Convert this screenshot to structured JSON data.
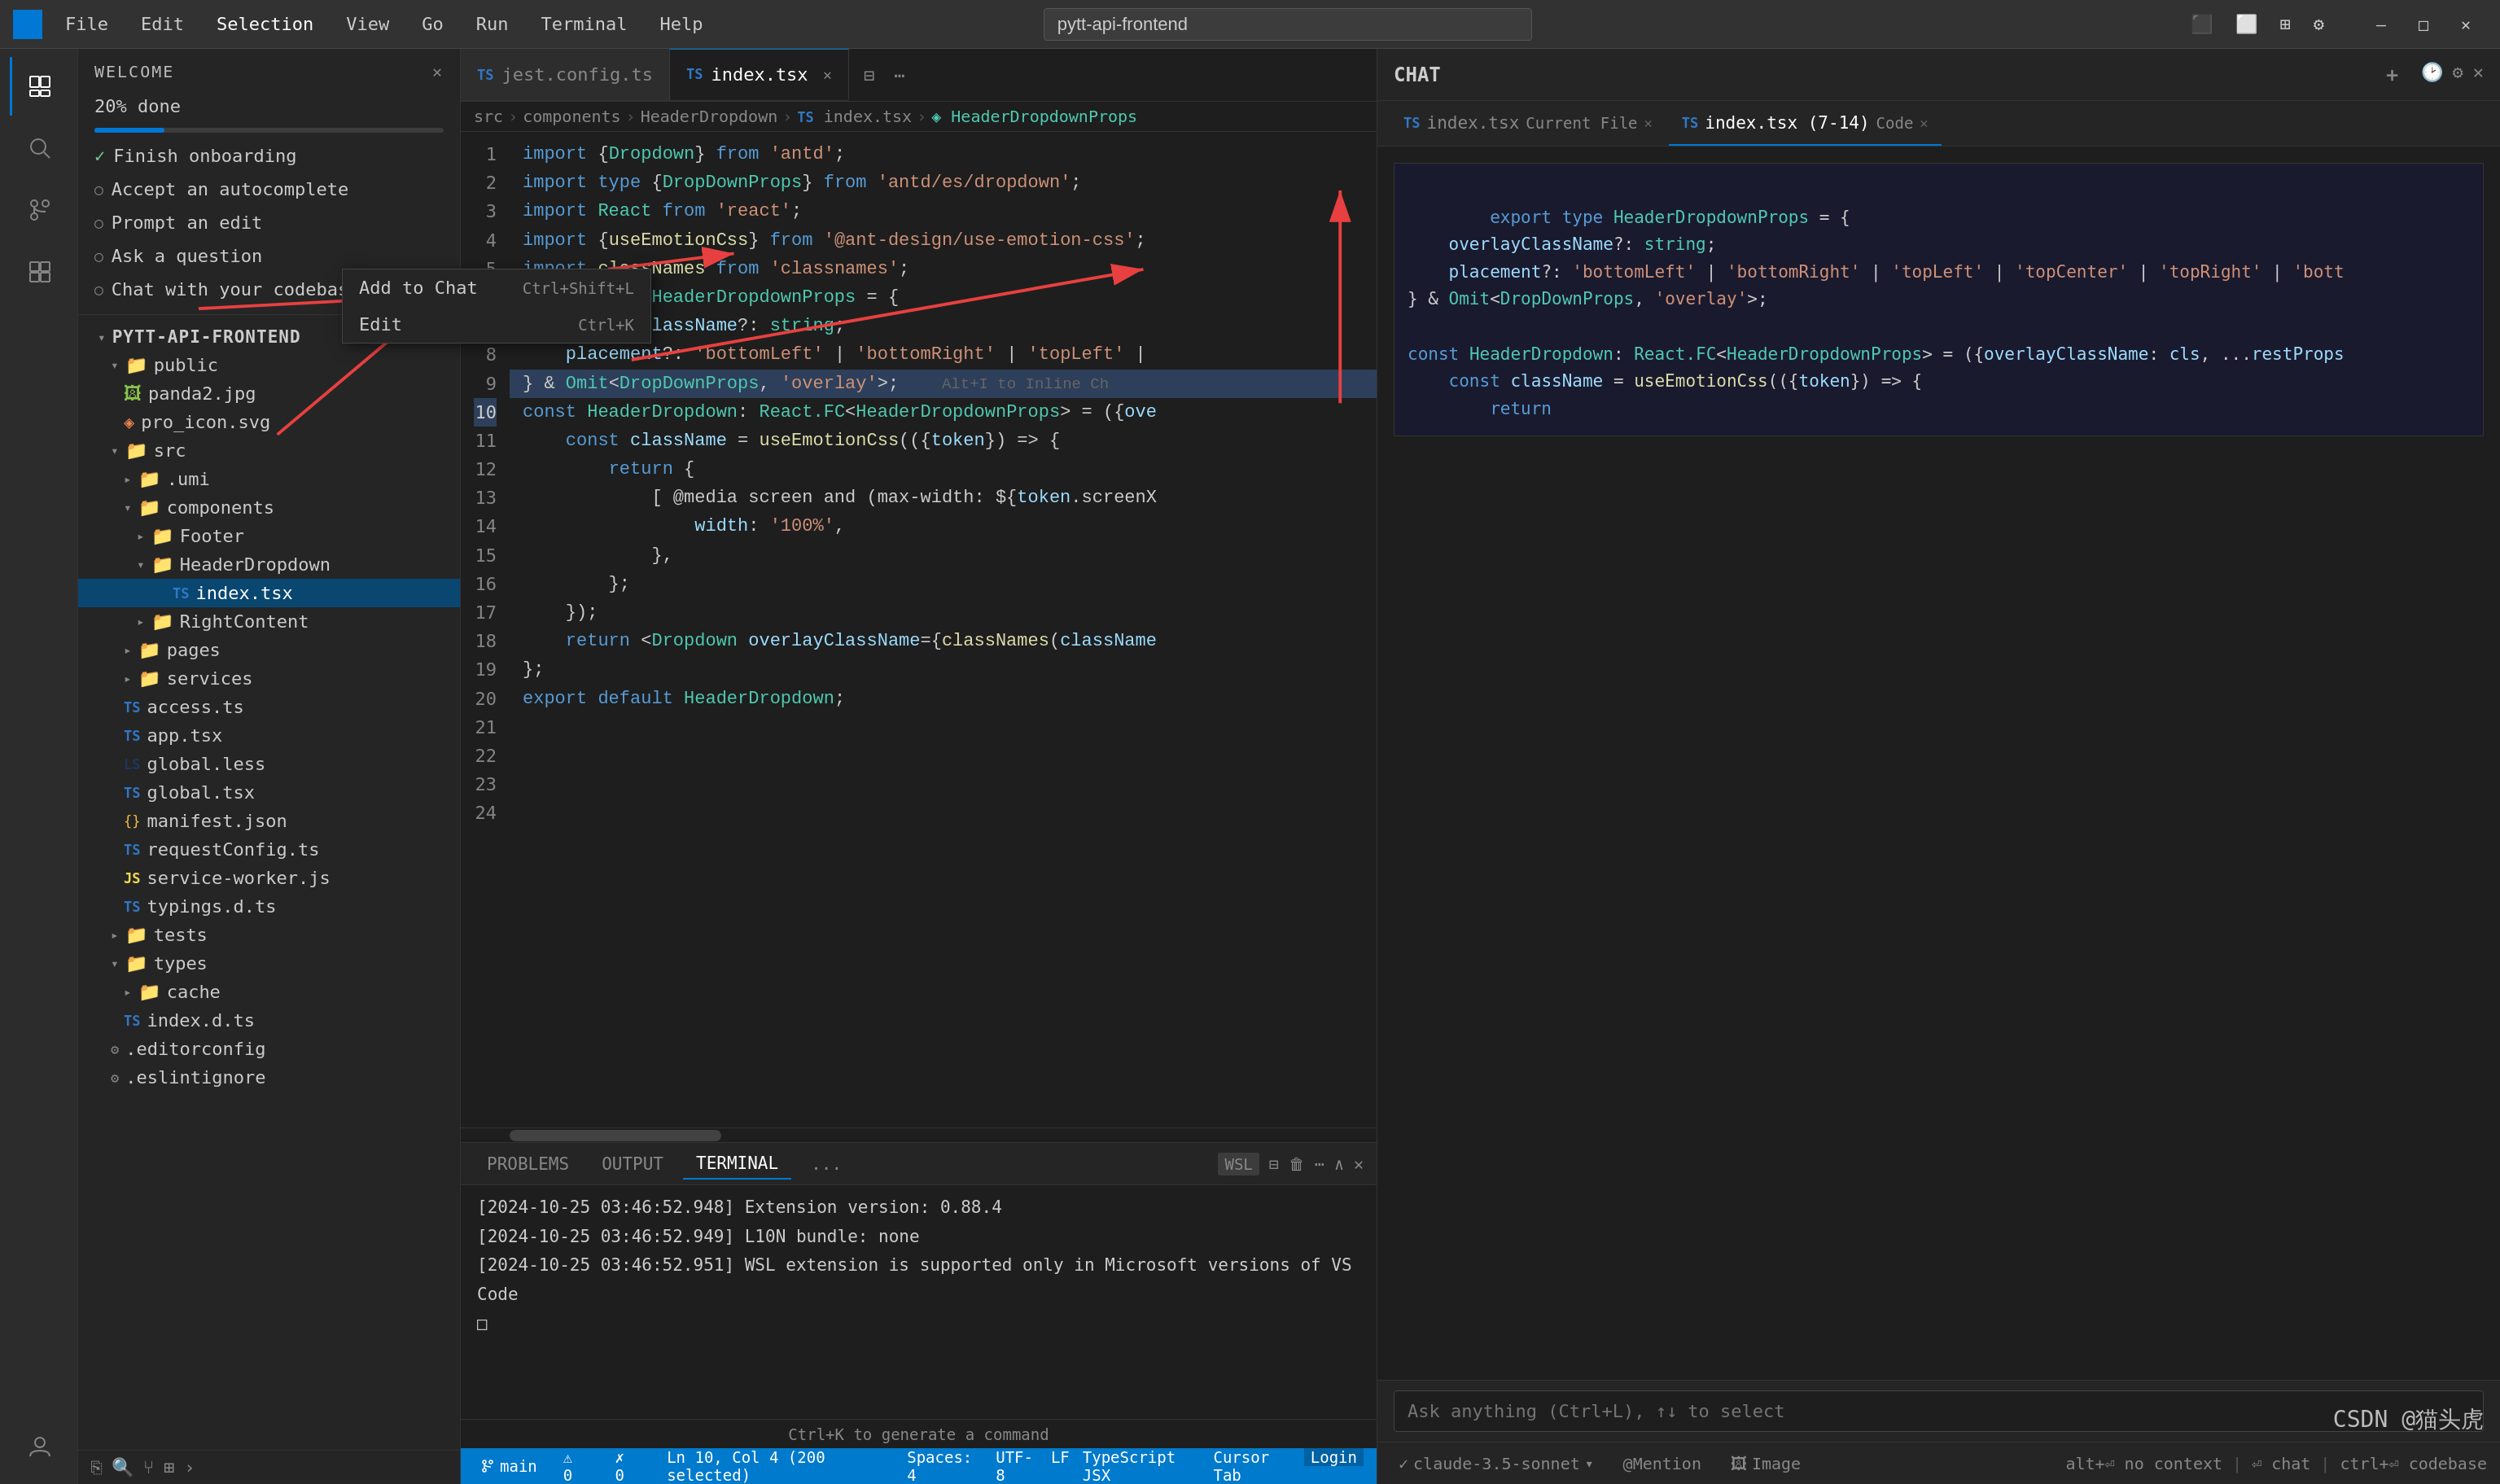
{
  "titlebar": {
    "logo": "⬡",
    "menu": [
      "File",
      "Edit",
      "Selection",
      "View",
      "Go",
      "Run",
      "Terminal",
      "Help"
    ],
    "search": "pytt-api-frontend",
    "controls": [
      "⊞",
      "⊟",
      "⧉",
      "⚙",
      "—",
      "□",
      "✕"
    ]
  },
  "activitybar": {
    "icons": [
      "📁",
      "🔍",
      "⑂",
      "🔲",
      "🧩"
    ]
  },
  "welcome": {
    "title": "WELCOME",
    "progress": "20% done",
    "progress_pct": 20,
    "items": [
      {
        "label": "Finish onboarding",
        "done": true
      },
      {
        "label": "Accept an autocomplete",
        "done": false
      },
      {
        "label": "Prompt an edit",
        "done": false
      },
      {
        "label": "Ask a question",
        "done": false
      },
      {
        "label": "Chat with your codebase",
        "done": false
      }
    ]
  },
  "explorer": {
    "root": "PYTT-API-FRONTEND",
    "tree": [
      {
        "label": "public",
        "indent": 1,
        "type": "folder",
        "open": true
      },
      {
        "label": "panda2.jpg",
        "indent": 2,
        "type": "file",
        "ext": "png"
      },
      {
        "label": "pro_icon.svg",
        "indent": 2,
        "type": "file",
        "ext": "svg"
      },
      {
        "label": "src",
        "indent": 1,
        "type": "folder",
        "open": true
      },
      {
        "label": ".umi",
        "indent": 2,
        "type": "folder",
        "open": false
      },
      {
        "label": "components",
        "indent": 2,
        "type": "folder",
        "open": true
      },
      {
        "label": "Footer",
        "indent": 3,
        "type": "folder",
        "open": false
      },
      {
        "label": "HeaderDropdown",
        "indent": 3,
        "type": "folder",
        "open": true
      },
      {
        "label": "index.tsx",
        "indent": 4,
        "type": "file",
        "ext": "tsx",
        "active": true
      },
      {
        "label": "RightContent",
        "indent": 3,
        "type": "folder",
        "open": false
      },
      {
        "label": "pages",
        "indent": 2,
        "type": "folder",
        "open": false
      },
      {
        "label": "services",
        "indent": 2,
        "type": "folder",
        "open": false
      },
      {
        "label": "access.ts",
        "indent": 2,
        "type": "file",
        "ext": "ts"
      },
      {
        "label": "app.tsx",
        "indent": 2,
        "type": "file",
        "ext": "tsx"
      },
      {
        "label": "global.less",
        "indent": 2,
        "type": "file",
        "ext": "less"
      },
      {
        "label": "global.tsx",
        "indent": 2,
        "type": "file",
        "ext": "tsx"
      },
      {
        "label": "manifest.json",
        "indent": 2,
        "type": "file",
        "ext": "json"
      },
      {
        "label": "requestConfig.ts",
        "indent": 2,
        "type": "file",
        "ext": "ts"
      },
      {
        "label": "service-worker.js",
        "indent": 2,
        "type": "file",
        "ext": "js"
      },
      {
        "label": "typings.d.ts",
        "indent": 2,
        "type": "file",
        "ext": "ts"
      },
      {
        "label": "tests",
        "indent": 1,
        "type": "folder",
        "open": false
      },
      {
        "label": "types",
        "indent": 1,
        "type": "folder",
        "open": true
      },
      {
        "label": "cache",
        "indent": 2,
        "type": "folder",
        "open": false
      },
      {
        "label": "index.d.ts",
        "indent": 2,
        "type": "file",
        "ext": "ts"
      },
      {
        "label": ".editorconfig",
        "indent": 1,
        "type": "file",
        "ext": "config"
      },
      {
        "label": ".eslintignore",
        "indent": 1,
        "type": "file",
        "ext": "config"
      }
    ]
  },
  "tabs": [
    {
      "label": "jest.config.ts",
      "ext": "ts",
      "active": false,
      "modified": false
    },
    {
      "label": "index.tsx",
      "ext": "tsx",
      "active": true,
      "modified": true
    }
  ],
  "breadcrumb": [
    "src",
    ">",
    "components",
    ">",
    "HeaderDropdown",
    ">",
    "index.tsx",
    ">",
    "HeaderDropdownProps"
  ],
  "code": {
    "lines": [
      {
        "num": 1,
        "content": "import {Dropdown} from 'antd';"
      },
      {
        "num": 2,
        "content": "import type {DropDownProps} from 'antd/es/dropdown';"
      },
      {
        "num": 3,
        "content": "import React from 'react';"
      },
      {
        "num": 4,
        "content": "import {useEmotionCss} from '@ant-design/use-emotion-css';"
      },
      {
        "num": 5,
        "content": "import classNames from 'classnames';"
      },
      {
        "num": 6,
        "content": ""
      },
      {
        "num": 7,
        "content": "export type HeaderDropdownProps = {"
      },
      {
        "num": 8,
        "content": "    overlayClassName?: string;"
      },
      {
        "num": 9,
        "content": "    placement?: 'bottomLeft' | 'bottomRight' | 'topLeft' |"
      },
      {
        "num": 10,
        "content": "} & Omit<DropDownProps, 'overlay'>;",
        "highlighted": true
      },
      {
        "num": 11,
        "content": ""
      },
      {
        "num": 12,
        "content": "const HeaderDropdown: React.FC<HeaderDropdownProps> = ({ove"
      },
      {
        "num": 13,
        "content": "    const className = useEmotionCss(({token}) => {"
      },
      {
        "num": 14,
        "content": "        return {"
      },
      {
        "num": 15,
        "content": "            [ @media screen and (max-width: ${token.screenX"
      },
      {
        "num": 16,
        "content": "                width: '100%',"
      },
      {
        "num": 17,
        "content": "            },"
      },
      {
        "num": 18,
        "content": "        };"
      },
      {
        "num": 19,
        "content": "    });"
      },
      {
        "num": 20,
        "content": "    return <Dropdown overlayClassName={classNames(className"
      },
      {
        "num": 21,
        "content": "};"
      },
      {
        "num": 22,
        "content": ""
      },
      {
        "num": 23,
        "content": "export default HeaderDropdown;"
      },
      {
        "num": 24,
        "content": ""
      }
    ]
  },
  "context_menu": {
    "items": [
      {
        "label": "Add to Chat",
        "shortcut": "Ctrl+Shift+L"
      },
      {
        "label": "Edit",
        "shortcut": "Ctrl+K"
      }
    ]
  },
  "terminal": {
    "tabs": [
      "PROBLEMS",
      "OUTPUT",
      "TERMINAL",
      "..."
    ],
    "active_tab": "TERMINAL",
    "wsl": "WSL",
    "lines": [
      "[2024-10-25 03:46:52.948] Extension version: 0.88.4",
      "[2024-10-25 03:46:52.949] L10N bundle: none",
      "[2024-10-25 03:46:52.951] WSL extension is supported only in Microsoft versions of VS Code",
      "□"
    ]
  },
  "statusbar": {
    "left": [
      "⎇ main",
      "⚠ 0",
      "✗ 0"
    ],
    "right": [
      "Ln 10, Col 4 (200 selected)",
      "Spaces: 4",
      "UTF-8",
      "LF",
      "{}",
      "TypeScript JSX",
      "Cursor Tab",
      "Login"
    ]
  },
  "chat": {
    "title": "CHAT",
    "tabs": [
      {
        "label": "index.tsx",
        "sub": "Current File",
        "active": false
      },
      {
        "label": "index.tsx (7-14)",
        "sub": "Code",
        "active": false
      }
    ],
    "code_block": {
      "lines": [
        "export type HeaderDropdownProps = {",
        "    overlayClassName?: string;",
        "    placement?: 'bottomLeft' | 'bottomRight' | 'topLeft' | 'topCenter' | 'topRight' | 'bott",
        "} & Omit<DropDownProps, 'overlay'>;",
        "",
        "const HeaderDropdown: React.FC<HeaderDropdownProps> = ({overlayClassName: cls, ...restProps",
        "    const className = useEmotionCss(({token}) => {",
        "        return"
      ]
    },
    "input_placeholder": "Ask anything (Ctrl+L), ↑↓ to select",
    "footer": {
      "model": "claude-3.5-sonnet",
      "mention": "@Mention",
      "image": "Image",
      "right": [
        "alt+⏎ no context",
        "⏎ chat",
        "ctrl+⏎ codebase"
      ]
    }
  }
}
